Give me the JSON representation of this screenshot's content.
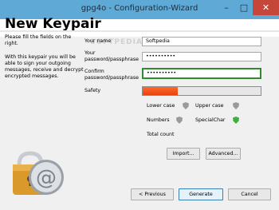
{
  "window": {
    "title": "gpg4o - Configuration-Wizard"
  },
  "page": {
    "title": "New Keypair"
  },
  "intro": [
    "Please fill the fields on the right.",
    "With this keypair you will be able to sign your outgoing messages, receive and decrypt encrypted messages."
  ],
  "fields": {
    "name_label": "Your name",
    "name_value": "Softpedia",
    "password_label": "Your password/passphrase",
    "password_value": "••••••••••",
    "confirm_label": "Confirm password/passphrase",
    "confirm_value": "••••••••••",
    "safety_label": "Safety",
    "safety_level": 0.3
  },
  "criteria": {
    "lower_case": "Lower case",
    "upper_case": "Upper case",
    "numbers": "Numbers",
    "special_char": "SpecialChar",
    "total_count": "Total count"
  },
  "buttons": {
    "import": "Import...",
    "advanced": "Advanced...",
    "previous": "< Previous",
    "generate": "Generate",
    "cancel": "Cancel"
  },
  "watermark": "SOFTPEDIA",
  "window_controls": {
    "minimize": "–",
    "maximize": "□",
    "close": "✕"
  },
  "colors": {
    "accent_title": "#5fa9d6",
    "safety_fill": "#e8410f",
    "confirm_border": "#2e8b2e",
    "close": "#c7463a"
  }
}
